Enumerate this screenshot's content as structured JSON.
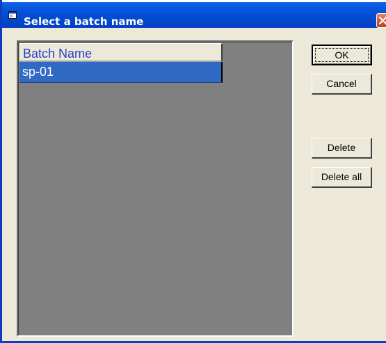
{
  "window": {
    "title": "Select a batch name",
    "app_icon": "window-app-icon",
    "close_icon": "close-icon"
  },
  "list": {
    "column_header": "Batch Name",
    "rows": [
      {
        "value": "sp-01",
        "selected": true
      }
    ]
  },
  "buttons": {
    "ok": "OK",
    "cancel": "Cancel",
    "delete": "Delete",
    "delete_all": "Delete all"
  },
  "colors": {
    "titlebar": "#0550d8",
    "selection": "#316ac5",
    "list_background": "#808080",
    "header_text": "#2a3fc8",
    "dialog_face": "#ece9d8",
    "close_button": "#d75a3b"
  }
}
